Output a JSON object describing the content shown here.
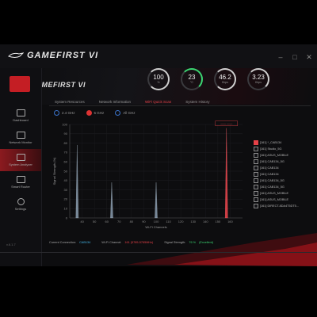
{
  "app": {
    "title": "GAMEFIRST VI",
    "section_title": "GAMEFIRST VI"
  },
  "window_controls": [
    "min",
    "max",
    "close"
  ],
  "gauges": [
    {
      "value": "100",
      "unit": "%"
    },
    {
      "value": "23",
      "unit": "°C"
    },
    {
      "value": "46.2",
      "unit": "Kbps"
    },
    {
      "value": "3.23",
      "unit": "Kbps"
    }
  ],
  "sidebar": {
    "items": [
      {
        "label": "Dashboard",
        "icon": "dashboard-icon",
        "active": false
      },
      {
        "label": "Network Monitor",
        "icon": "network-monitor-icon",
        "active": false
      },
      {
        "label": "System Analyzer",
        "icon": "system-analyzer-icon",
        "active": true
      },
      {
        "label": "Smart Router",
        "icon": "router-icon",
        "active": false
      },
      {
        "label": "Settings",
        "icon": "gear-icon",
        "active": false
      }
    ],
    "version": "v.6.1.7"
  },
  "tabs": [
    {
      "label": "System Resources",
      "active": false
    },
    {
      "label": "Network Information",
      "active": false
    },
    {
      "label": "WiFi Quick Scan",
      "active": true
    },
    {
      "label": "System History",
      "active": false
    }
  ],
  "bands": [
    {
      "label": "2.4 GHz",
      "selected": false
    },
    {
      "label": "5 GHz",
      "selected": true
    },
    {
      "label": "All GHz",
      "selected": false
    }
  ],
  "chart_data": {
    "type": "line",
    "ylabel": "Signal Strength (%)",
    "xlabel": "Wi-Fi Channels",
    "ylim": [
      0,
      100
    ],
    "xlim": [
      30,
      170
    ],
    "y_ticks": [
      0,
      10,
      20,
      30,
      40,
      50,
      60,
      70,
      80,
      90,
      100
    ],
    "x_ticks": [
      40,
      50,
      60,
      70,
      80,
      90,
      100,
      110,
      120,
      130,
      140,
      150,
      160
    ],
    "peaks": [
      {
        "channel": 36,
        "strength": 78
      },
      {
        "channel": 64,
        "strength": 38
      },
      {
        "channel": 100,
        "strength": 38
      },
      {
        "channel": 157,
        "strength": 96
      }
    ],
    "annotation": "—— ——"
  },
  "legend": [
    {
      "label": "[161] *_CAB134",
      "highlight": true
    },
    {
      "label": "[161] Studio_5G",
      "highlight": false
    },
    {
      "label": "[161] ASUS_MOBILE",
      "highlight": false
    },
    {
      "label": "[161] CAB134_5G",
      "highlight": false
    },
    {
      "label": "[161] CAB134",
      "highlight": false
    },
    {
      "label": "[161] CAB134",
      "highlight": false
    },
    {
      "label": "[161] CAB134_5G",
      "highlight": false
    },
    {
      "label": "[161] CAB134_5G",
      "highlight": false
    },
    {
      "label": "[161] ASUS_MOBILE",
      "highlight": false
    },
    {
      "label": "[161] ASUS_MOBILE",
      "highlight": false
    },
    {
      "label": "[161] DIRECT-8DA4T5DT5...",
      "highlight": false
    }
  ],
  "status": {
    "conn_label": "Current Connection",
    "conn_value": "CAB134",
    "channel_label": "Wi-Fi Channel",
    "channel_value": "161 (5785-5765MHz)",
    "signal_label": "Signal Strength",
    "signal_value": "76 %",
    "signal_note": "(Excellent)"
  },
  "colors": {
    "accent": "#e64148",
    "brand_red": "#c41e24",
    "bg": "#0d0d0f"
  }
}
